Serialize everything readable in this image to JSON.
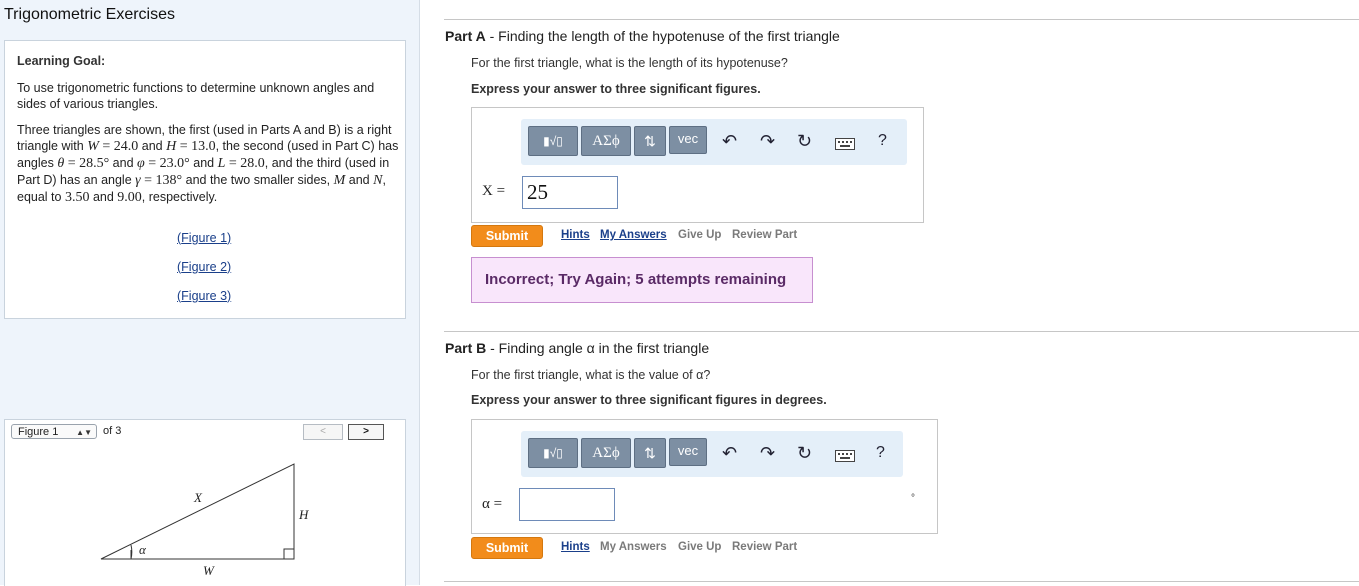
{
  "app_title": "Trigonometric Exercises",
  "goal": {
    "heading": "Learning Goal:",
    "p1": "To use trigonometric functions to determine unknown angles and sides of various triangles.",
    "p2": {
      "t1": "Three triangles are shown, the first (used in Parts A and B) is a right triangle with ",
      "W": "W",
      "eq1": " = 24.0",
      "t2": " and ",
      "H": "H",
      "eq2": " = 13.0",
      "t3": ", the second (used in Part C) has angles ",
      "theta": "θ",
      "eq3": " = 28.5°",
      "t4": " and ",
      "phi": "φ",
      "eq4": " = 23.0°",
      "t5": " and ",
      "L": "L",
      "eq5": " = 28.0",
      "t6": ", and the third (used in Part D) has an angle ",
      "gamma": "γ",
      "eq6": " = 138°",
      "t7": " and the two smaller sides, ",
      "M": "M",
      "t8": " and ",
      "N": "N",
      "t9": ", equal to ",
      "v1": "3.50",
      "t10": " and ",
      "v2": "9.00",
      "t11": ", respectively."
    },
    "figure_links": [
      "Figure 1",
      "Figure 2",
      "Figure 3"
    ]
  },
  "figure_panel": {
    "selected": "Figure 1",
    "of_text": "of 3",
    "prev": "<",
    "next": ">",
    "labels": {
      "X": "X",
      "H": "H",
      "W": "W",
      "alpha": "α"
    }
  },
  "toolbar": {
    "templates": "√",
    "greek": "ΑΣϕ",
    "arrows": "⇅",
    "vec": "vec",
    "undo": "↶",
    "redo": "↷",
    "reset": "↻",
    "help": "?"
  },
  "partA": {
    "title_bold": "Part A",
    "title_rest": " - Finding the length of the hypotenuse of the first triangle",
    "question": "For the first triangle, what is the length of its hypotenuse?",
    "instruction": "Express your answer to three significant figures.",
    "var_label": "X =",
    "answer_value": "25",
    "submit": "Submit",
    "links": {
      "hints": "Hints",
      "my_answers": "My Answers",
      "give_up": "Give Up",
      "review": "Review Part"
    },
    "feedback": "Incorrect; Try Again; 5 attempts remaining"
  },
  "partB": {
    "title_bold": "Part B",
    "title_rest": " - Finding angle α in the first triangle",
    "question": "For the first triangle, what is the value of α?",
    "instruction": "Express your answer to three significant figures in degrees.",
    "var_label": "α =",
    "answer_value": "",
    "unit": "°",
    "submit": "Submit",
    "links": {
      "hints": "Hints",
      "my_answers": "My Answers",
      "give_up": "Give Up",
      "review": "Review Part"
    }
  }
}
